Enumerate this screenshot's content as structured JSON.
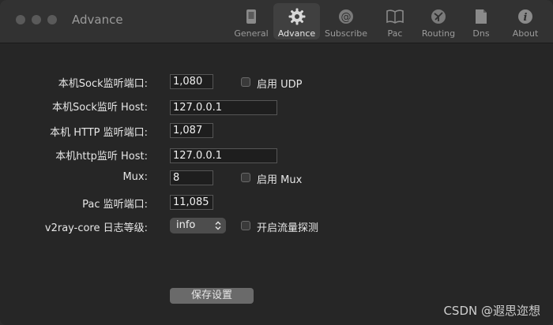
{
  "window": {
    "title": "Advance"
  },
  "toolbar": [
    {
      "key": "general",
      "label": "General",
      "icon": "phone-icon"
    },
    {
      "key": "advance",
      "label": "Advance",
      "icon": "gear-icon"
    },
    {
      "key": "subscribe",
      "label": "Subscribe",
      "icon": "at-icon"
    },
    {
      "key": "pac",
      "label": "Pac",
      "icon": "book-icon"
    },
    {
      "key": "routing",
      "label": "Routing",
      "icon": "routing-icon"
    },
    {
      "key": "dns",
      "label": "Dns",
      "icon": "document-icon"
    },
    {
      "key": "about",
      "label": "About",
      "icon": "info-icon"
    }
  ],
  "form": {
    "sock_port_label": "本机Sock监听端口:",
    "sock_port_value": "1,080",
    "udp_label": "启用 UDP",
    "sock_host_label": "本机Sock监听 Host:",
    "sock_host_value": "127.0.0.1",
    "http_port_label": "本机 HTTP 监听端口:",
    "http_port_value": "1,087",
    "http_host_label": "本机http监听 Host:",
    "http_host_value": "127.0.0.1",
    "mux_label": "Mux:",
    "mux_value": "8",
    "mux_enable_label": "启用 Mux",
    "pac_port_label": "Pac 监听端口:",
    "pac_port_value": "11,085",
    "log_level_label": "v2ray-core 日志等级:",
    "log_level_value": "info",
    "traffic_label": "开启流量探测"
  },
  "save_label": "保存设置",
  "watermark": "CSDN @遐思迩想"
}
